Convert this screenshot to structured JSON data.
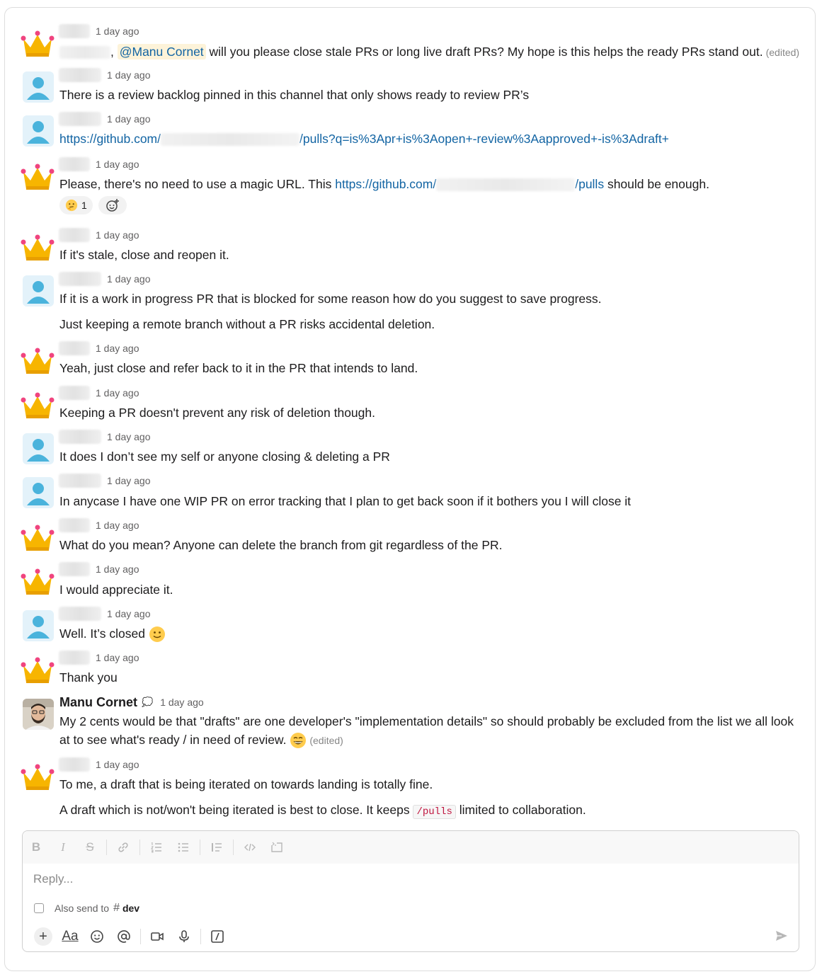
{
  "messages": [
    {
      "avatar": "crown",
      "name": "",
      "time": "1 day ago",
      "text": "",
      "mention": "@Manu Cornet",
      "rest": " will you please close stale PRs or long live draft PRs? My hope is this helps the ready PRs stand out.",
      "edited": "(edited)"
    },
    {
      "avatar": "user",
      "time": "1 day ago",
      "text": "There is a review backlog pinned in this channel that only shows ready to review PR’s"
    },
    {
      "avatar": "user",
      "time": "1 day ago",
      "link_a": "https://github.com/",
      "link_b": "/pulls?q=is%3Apr+is%3Aopen+-review%3Aapproved+-is%3Adraft+"
    },
    {
      "avatar": "crown",
      "time": "1 day ago",
      "text_a": "Please, there's no need to use a magic URL. This ",
      "link_a": "https://github.com/",
      "link_b": "/pulls",
      "text_b": " should be enough.",
      "reaction_count": "1"
    },
    {
      "avatar": "crown",
      "time": "1 day ago",
      "text": "If it's stale, close and reopen it."
    },
    {
      "avatar": "user",
      "time": "1 day ago",
      "text": "If it is a work in progress PR that is blocked for some reason how do you suggest to save progress.",
      "text2": "Just keeping a remote branch without a PR risks accidental deletion."
    },
    {
      "avatar": "crown",
      "time": "1 day ago",
      "text": "Yeah, just close and refer back to it in the PR that intends to land."
    },
    {
      "avatar": "crown",
      "time": "1 day ago",
      "text": "Keeping a PR doesn't prevent any risk of deletion though."
    },
    {
      "avatar": "user",
      "time": "1 day ago",
      "text": "It does I don’t see my self or anyone closing & deleting a PR"
    },
    {
      "avatar": "user",
      "time": "1 day ago",
      "text": "In anycase I have one WIP PR on error tracking that I plan to get back soon if it bothers you I will close it"
    },
    {
      "avatar": "crown",
      "time": "1 day ago",
      "text": "What do you mean? Anyone can delete the branch from git regardless of the PR."
    },
    {
      "avatar": "crown",
      "time": "1 day ago",
      "text": "I would appreciate it."
    },
    {
      "avatar": "user",
      "time": "1 day ago",
      "text": "Well. It’s closed"
    },
    {
      "avatar": "crown",
      "time": "1 day ago",
      "text": "Thank you"
    },
    {
      "avatar": "photo",
      "name": "Manu Cornet",
      "time": "1 day ago",
      "text": "My 2 cents would be that \"drafts\" are one developer's \"implementation details\" so should probably be excluded from the list we all look at to see what's ready / in  need of review.",
      "edited": "(edited)"
    },
    {
      "avatar": "crown",
      "time": "1 day ago",
      "text": "To me, a draft that is being iterated on towards landing is totally fine.",
      "text2_a": "A draft which is not/won't being iterated is best to close. It keeps ",
      "code": "/pulls",
      "text2_b": " limited to collaboration."
    }
  ],
  "composer": {
    "placeholder": "Reply...",
    "also_send": "Also send to",
    "channel": "dev"
  },
  "colors": {
    "link": "#1264a3",
    "mention_bg": "#fdf3d9",
    "code": "#c0153f",
    "user_avatar": "#4ab3dc",
    "crown": "#f7b500"
  },
  "icons": [
    "bold-icon",
    "italic-icon",
    "strikethrough-icon",
    "link-icon",
    "ordered-list-icon",
    "bullet-list-icon",
    "blockquote-icon",
    "code-icon",
    "code-block-icon",
    "plus-icon",
    "format-icon",
    "emoji-icon",
    "mention-icon",
    "video-icon",
    "microphone-icon",
    "slash-command-icon",
    "send-icon"
  ]
}
